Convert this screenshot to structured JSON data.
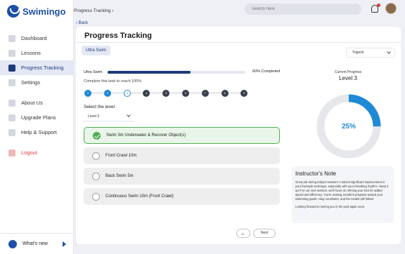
{
  "app": {
    "name": "Swimingo"
  },
  "sidebar": {
    "items": [
      {
        "label": "Dashboard",
        "icon": "dashboard-icon"
      },
      {
        "label": "Lessons",
        "icon": "book-icon"
      },
      {
        "label": "Progress Tracking",
        "icon": "chart-icon",
        "active": true
      },
      {
        "label": "Settings",
        "icon": "gear-icon"
      }
    ],
    "secondary": [
      {
        "label": "About Us",
        "icon": "info-icon"
      },
      {
        "label": "Upgrade Plans",
        "icon": "upgrade-icon"
      },
      {
        "label": "Help & Support",
        "icon": "help-icon"
      }
    ],
    "logout": "Logout",
    "whats_new": "What's new"
  },
  "header": {
    "breadcrumb": "Progress Tracking",
    "search_placeholder": "Search here"
  },
  "page": {
    "back": "Back",
    "title": "Progress Tracking",
    "tab": "Ultra Swim",
    "user_select": "Yogesh",
    "progress": {
      "label": "Ultra Swim",
      "percent": 60,
      "text": "60% Completed",
      "note": "Complete this task to reach 100%"
    },
    "steps": [
      {
        "number": "1",
        "state": "done"
      },
      {
        "number": "2",
        "state": "done"
      },
      {
        "number": "3",
        "state": "current"
      },
      {
        "number": "4",
        "state": "todo"
      },
      {
        "number": "5",
        "state": "todo"
      },
      {
        "number": "6",
        "state": "todo"
      },
      {
        "number": "7",
        "state": "todo"
      },
      {
        "number": "8",
        "state": "todo"
      },
      {
        "number": "9",
        "state": "todo"
      }
    ],
    "level_label": "Select the level",
    "level_value": "Level 3",
    "options": [
      {
        "label": "Swim 3m Underwater & Recover Object(s)",
        "selected": true
      },
      {
        "label": "Front Crawl 10m",
        "selected": false
      },
      {
        "label": "Back Swim 5m",
        "selected": false
      },
      {
        "label": "Continuous Swim 10m (Front Crawl)",
        "selected": false
      }
    ],
    "back_arrow": "←",
    "next": "Next",
    "current_progress": {
      "label": "Current Progress",
      "level": "Level 3",
      "percent": 25,
      "percent_text": "25%"
    },
    "instructor_note": {
      "title": "Instructor's Note",
      "body": "Great job during today's session! I noticed significant improvement in your freestyle technique, especially with your breathing rhythm—keep it up! For our next session, we'll focus on refining your kick for added speed and efficiency. You're making excellent progress toward your swimming goals—stay consistent, and the results will follow!",
      "sign": "Looking forward to seeing you in the pool again soon."
    }
  },
  "colors": {
    "brand": "#1e4fa8",
    "ring": "#1e8ad6",
    "ring_track": "#e6e7ea",
    "success": "#4caf50"
  }
}
